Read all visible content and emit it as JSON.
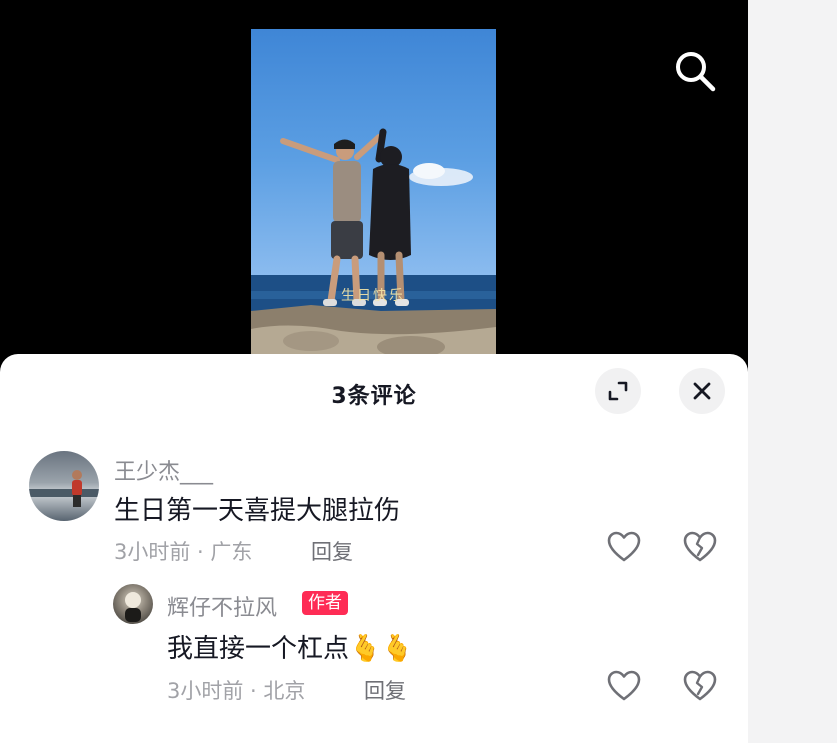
{
  "sheet": {
    "title": "3条评论"
  },
  "comments": [
    {
      "username": "王少杰___",
      "text": "生日第一天喜提大腿拉伤",
      "meta": "3小时前 · 广东",
      "reply_label": "回复",
      "replies": [
        {
          "username": "辉仔不拉风",
          "badge": "作者",
          "text": "我直接一个杠点",
          "emoji": "🫰🫰",
          "meta": "3小时前 · 北京",
          "reply_label": "回复"
        }
      ]
    }
  ],
  "video": {
    "caption": "生日快乐"
  },
  "icons": {
    "search": "search-icon",
    "expand": "expand-icon",
    "close": "close-icon",
    "like": "heart-icon",
    "dislike": "broken-heart-icon"
  },
  "colors": {
    "badge": "#fe2c55",
    "text_primary": "#161823",
    "text_secondary": "#a1a2a7"
  }
}
